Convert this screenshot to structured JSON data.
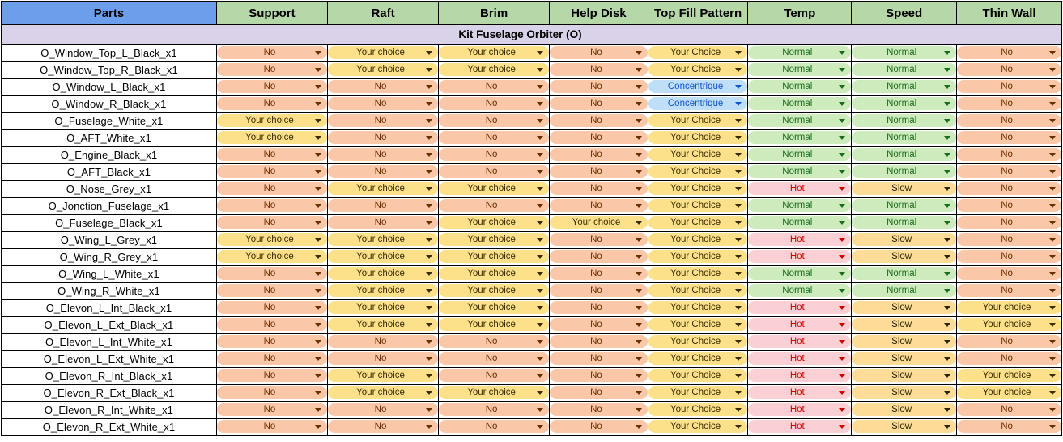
{
  "table": {
    "columns": [
      {
        "key": "parts",
        "label": "Parts",
        "style": "parts"
      },
      {
        "key": "support",
        "label": "Support",
        "style": "opt"
      },
      {
        "key": "raft",
        "label": "Raft",
        "style": "opt"
      },
      {
        "key": "brim",
        "label": "Brim",
        "style": "opt"
      },
      {
        "key": "helpdisk",
        "label": "Help Disk",
        "style": "opt"
      },
      {
        "key": "topfill",
        "label": "Top Fill Pattern",
        "style": "opt"
      },
      {
        "key": "temp",
        "label": "Temp",
        "style": "opt"
      },
      {
        "key": "speed",
        "label": "Speed",
        "style": "opt"
      },
      {
        "key": "thinwall",
        "label": "Thin Wall",
        "style": "opt"
      }
    ],
    "group_title": "Kit Fuselage Orbiter (O)",
    "rows": [
      {
        "part": "O_Window_Top_L_Black_x1",
        "values": [
          "No",
          "Your choice",
          "Your choice",
          "No",
          "Your Choice",
          "Normal",
          "Normal",
          "No"
        ]
      },
      {
        "part": "O_Window_Top_R_Black_x1",
        "values": [
          "No",
          "Your choice",
          "Your choice",
          "No",
          "Your Choice",
          "Normal",
          "Normal",
          "No"
        ]
      },
      {
        "part": "O_Window_L_Black_x1",
        "values": [
          "No",
          "No",
          "No",
          "No",
          "Concentrique",
          "Normal",
          "Normal",
          "No"
        ]
      },
      {
        "part": "O_Window_R_Black_x1",
        "values": [
          "No",
          "No",
          "No",
          "No",
          "Concentrique",
          "Normal",
          "Normal",
          "No"
        ]
      },
      {
        "part": "O_Fuselage_White_x1",
        "values": [
          "Your choice",
          "No",
          "No",
          "No",
          "Your Choice",
          "Normal",
          "Normal",
          "No"
        ]
      },
      {
        "part": "O_AFT_White_x1",
        "values": [
          "Your choice",
          "No",
          "No",
          "No",
          "Your Choice",
          "Normal",
          "Normal",
          "No"
        ]
      },
      {
        "part": "O_Engine_Black_x1",
        "values": [
          "No",
          "No",
          "No",
          "No",
          "Your Choice",
          "Normal",
          "Normal",
          "No"
        ]
      },
      {
        "part": "O_AFT_Black_x1",
        "values": [
          "No",
          "No",
          "No",
          "No",
          "Your Choice",
          "Normal",
          "Normal",
          "No"
        ]
      },
      {
        "part": "O_Nose_Grey_x1",
        "values": [
          "No",
          "Your choice",
          "Your choice",
          "No",
          "Your Choice",
          "Hot",
          "Slow",
          "No"
        ]
      },
      {
        "part": "O_Jonction_Fuselage_x1",
        "values": [
          "No",
          "No",
          "No",
          "No",
          "Your Choice",
          "Normal",
          "Normal",
          "No"
        ]
      },
      {
        "part": "O_Fuselage_Black_x1",
        "values": [
          "No",
          "No",
          "Your choice",
          "Your choice",
          "Your Choice",
          "Normal",
          "Normal",
          "No"
        ]
      },
      {
        "part": "O_Wing_L_Grey_x1",
        "values": [
          "Your choice",
          "Your choice",
          "Your choice",
          "No",
          "Your Choice",
          "Hot",
          "Slow",
          "No"
        ]
      },
      {
        "part": "O_Wing_R_Grey_x1",
        "values": [
          "Your choice",
          "Your choice",
          "Your choice",
          "No",
          "Your Choice",
          "Hot",
          "Slow",
          "No"
        ]
      },
      {
        "part": "O_Wing_L_White_x1",
        "values": [
          "No",
          "Your choice",
          "Your choice",
          "No",
          "Your Choice",
          "Normal",
          "Normal",
          "No"
        ]
      },
      {
        "part": "O_Wing_R_White_x1",
        "values": [
          "No",
          "Your choice",
          "Your choice",
          "No",
          "Your Choice",
          "Normal",
          "Normal",
          "No"
        ]
      },
      {
        "part": "O_Elevon_L_Int_Black_x1",
        "values": [
          "No",
          "Your choice",
          "Your choice",
          "No",
          "Your Choice",
          "Hot",
          "Slow",
          "Your choice"
        ]
      },
      {
        "part": "O_Elevon_L_Ext_Black_x1",
        "values": [
          "No",
          "Your choice",
          "Your choice",
          "No",
          "Your Choice",
          "Hot",
          "Slow",
          "Your choice"
        ]
      },
      {
        "part": "O_Elevon_L_Int_White_x1",
        "values": [
          "No",
          "No",
          "No",
          "No",
          "Your Choice",
          "Hot",
          "Slow",
          "No"
        ]
      },
      {
        "part": "O_Elevon_L_Ext_White_x1",
        "values": [
          "No",
          "No",
          "No",
          "No",
          "Your Choice",
          "Hot",
          "Slow",
          "No"
        ]
      },
      {
        "part": "O_Elevon_R_Int_Black_x1",
        "values": [
          "No",
          "Your choice",
          "No",
          "No",
          "Your Choice",
          "Hot",
          "Slow",
          "Your choice"
        ]
      },
      {
        "part": "O_Elevon_R_Ext_Black_x1",
        "values": [
          "No",
          "Your choice",
          "Your choice",
          "No",
          "Your Choice",
          "Hot",
          "Slow",
          "Your choice"
        ]
      },
      {
        "part": "O_Elevon_R_Int_White_x1",
        "values": [
          "No",
          "No",
          "No",
          "No",
          "Your Choice",
          "Hot",
          "Slow",
          "No"
        ]
      },
      {
        "part": "O_Elevon_R_Ext_White_x1",
        "values": [
          "No",
          "No",
          "No",
          "No",
          "Your Choice",
          "Hot",
          "Slow",
          "No"
        ]
      }
    ]
  },
  "colors": {
    "header_parts": "#6D9EEB",
    "header_option": "#B6D7A8",
    "group_row": "#D9D2E9",
    "chip_no": "#FAC7A8",
    "chip_your_choice": "#FCE08A",
    "chip_normal": "#CDEBBC",
    "chip_hot": "#FAD0D4",
    "chip_slow": "#FCDC96",
    "chip_concentrique": "#BEDFF7"
  },
  "icons": {
    "dropdown": "chevron-down-icon"
  }
}
